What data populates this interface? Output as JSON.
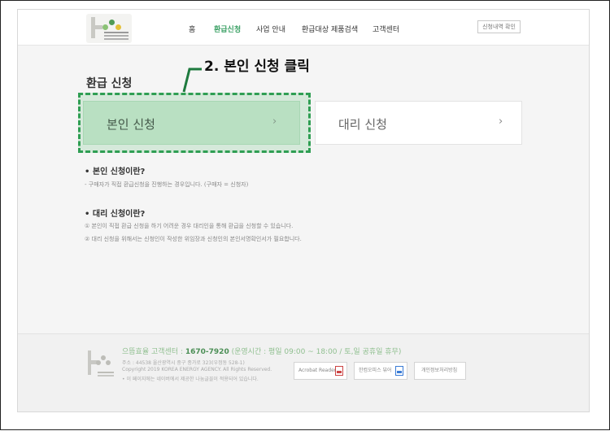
{
  "header": {
    "logo_name": "logo-icon",
    "nav": [
      "홈",
      "환급신청",
      "사업 안내",
      "환급대상 제품검색",
      "고객센터"
    ],
    "active_nav": "환급신청",
    "history_button": "신청내역 확인"
  },
  "page_title": "환급 신청",
  "annotation": "2. 본인 신청 클릭",
  "cards": {
    "self": {
      "label": "본인 신청",
      "chevron": "›"
    },
    "proxy": {
      "label": "대리 신청",
      "chevron": "›"
    }
  },
  "info": {
    "self_heading": "• 본인 신청이란?",
    "self_text": "- 구매자가 직접 환급신청을 진행하는 경우입니다. (구매자 = 신청자)",
    "proxy_heading": "• 대리 신청이란?",
    "proxy_line1": "① 본인이 직접 환급 신청을 하기 어려운 경우 대리인을 통해 환급을 신청할 수 있습니다.",
    "proxy_line2": "② 대리 신청을 위해서는 신청인이 작성한 위임장과 신청인의 본인서명확인서가 필요합니다."
  },
  "footer": {
    "cs_prefix": "으뜸효율 고객센터 :",
    "cs_phone": "1670-7920",
    "cs_hours": "(운영시간 : 평일 09:00 ~ 18:00 / 토,일 공휴일 휴무)",
    "address": "주소 : 44538 울산광역시 중구 종가로 323(우정동 528-1)",
    "copyright": "Copyright 2019 KOREA ENERGY AGENCY. All Rights Reserved.",
    "notice": "• 이 페이지에는 네이버에서 제공한 나눔글꼴이 적용되어 있습니다.",
    "buttons": [
      "Acrobat Reader",
      "한컴오피스 뷰어",
      "개인정보처리방침"
    ]
  },
  "colors": {
    "accent": "#3aa064",
    "highlight": "#2f9e53",
    "self_card": "#cfe8d4"
  }
}
